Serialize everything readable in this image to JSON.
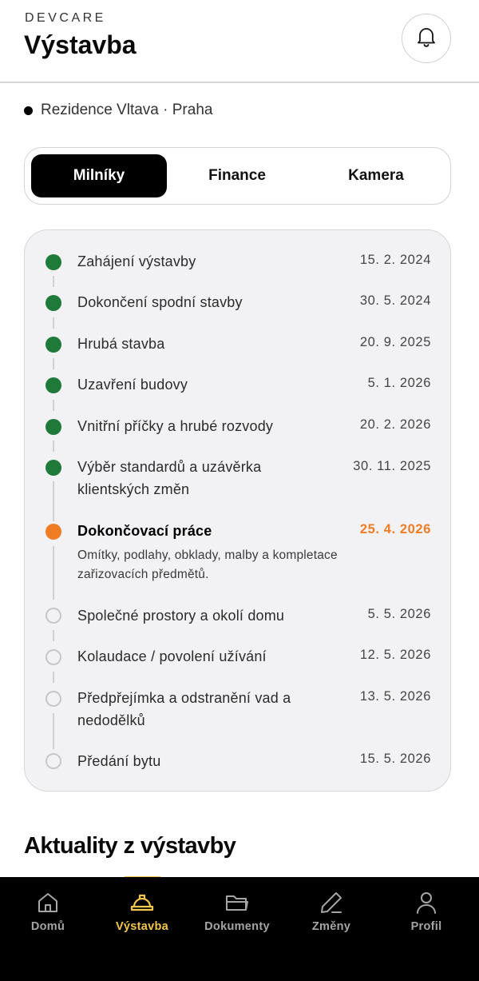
{
  "header": {
    "brand": "DEVCARE",
    "title": "Výstavba",
    "notification_icon": "bell-icon"
  },
  "project": {
    "label": "Rezidence Vltava · Praha"
  },
  "tabs": [
    {
      "label": "Milníky",
      "active": true
    },
    {
      "label": "Finance",
      "active": false
    },
    {
      "label": "Kamera",
      "active": false
    }
  ],
  "milestones": [
    {
      "title": "Zahájení výstavby",
      "date": "15. 2. 2024",
      "status": "done"
    },
    {
      "title": "Dokončení spodní stavby",
      "date": "30. 5. 2024",
      "status": "done"
    },
    {
      "title": "Hrubá stavba",
      "date": "20. 9. 2025",
      "status": "done"
    },
    {
      "title": "Uzavření budovy",
      "date": "5. 1. 2026",
      "status": "done"
    },
    {
      "title": "Vnitřní příčky a hrubé rozvody",
      "date": "20. 2. 2026",
      "status": "done"
    },
    {
      "title": "Výběr standardů a uzávěrka klientských změn",
      "date": "30. 11. 2025",
      "status": "done"
    },
    {
      "title": "Dokončovací práce",
      "date": "25. 4. 2026",
      "status": "current",
      "description": "Omítky, podlahy, obklady, malby a kompletace zařizovacích předmětů."
    },
    {
      "title": "Společné prostory a okolí domu",
      "date": "5. 5. 2026",
      "status": "upcoming"
    },
    {
      "title": "Kolaudace / povolení užívání",
      "date": "12. 5. 2026",
      "status": "upcoming"
    },
    {
      "title": "Předpřejímka a odstranění vad a nedodělků",
      "date": "13. 5. 2026",
      "status": "upcoming"
    },
    {
      "title": "Předání bytu",
      "date": "15. 5. 2026",
      "status": "upcoming"
    }
  ],
  "news": {
    "title": "Aktuality z výstavby"
  },
  "bottom_nav": [
    {
      "label": "Domů",
      "icon": "home-icon",
      "active": false
    },
    {
      "label": "Výstavba",
      "icon": "hardhat-icon",
      "active": true
    },
    {
      "label": "Dokumenty",
      "icon": "folder-icon",
      "active": false
    },
    {
      "label": "Změny",
      "icon": "pencil-icon",
      "active": false
    },
    {
      "label": "Profil",
      "icon": "user-icon",
      "active": false
    }
  ],
  "colors": {
    "done": "#1f7a3a",
    "current": "#f07c24",
    "nav_active": "#f3c64c"
  }
}
